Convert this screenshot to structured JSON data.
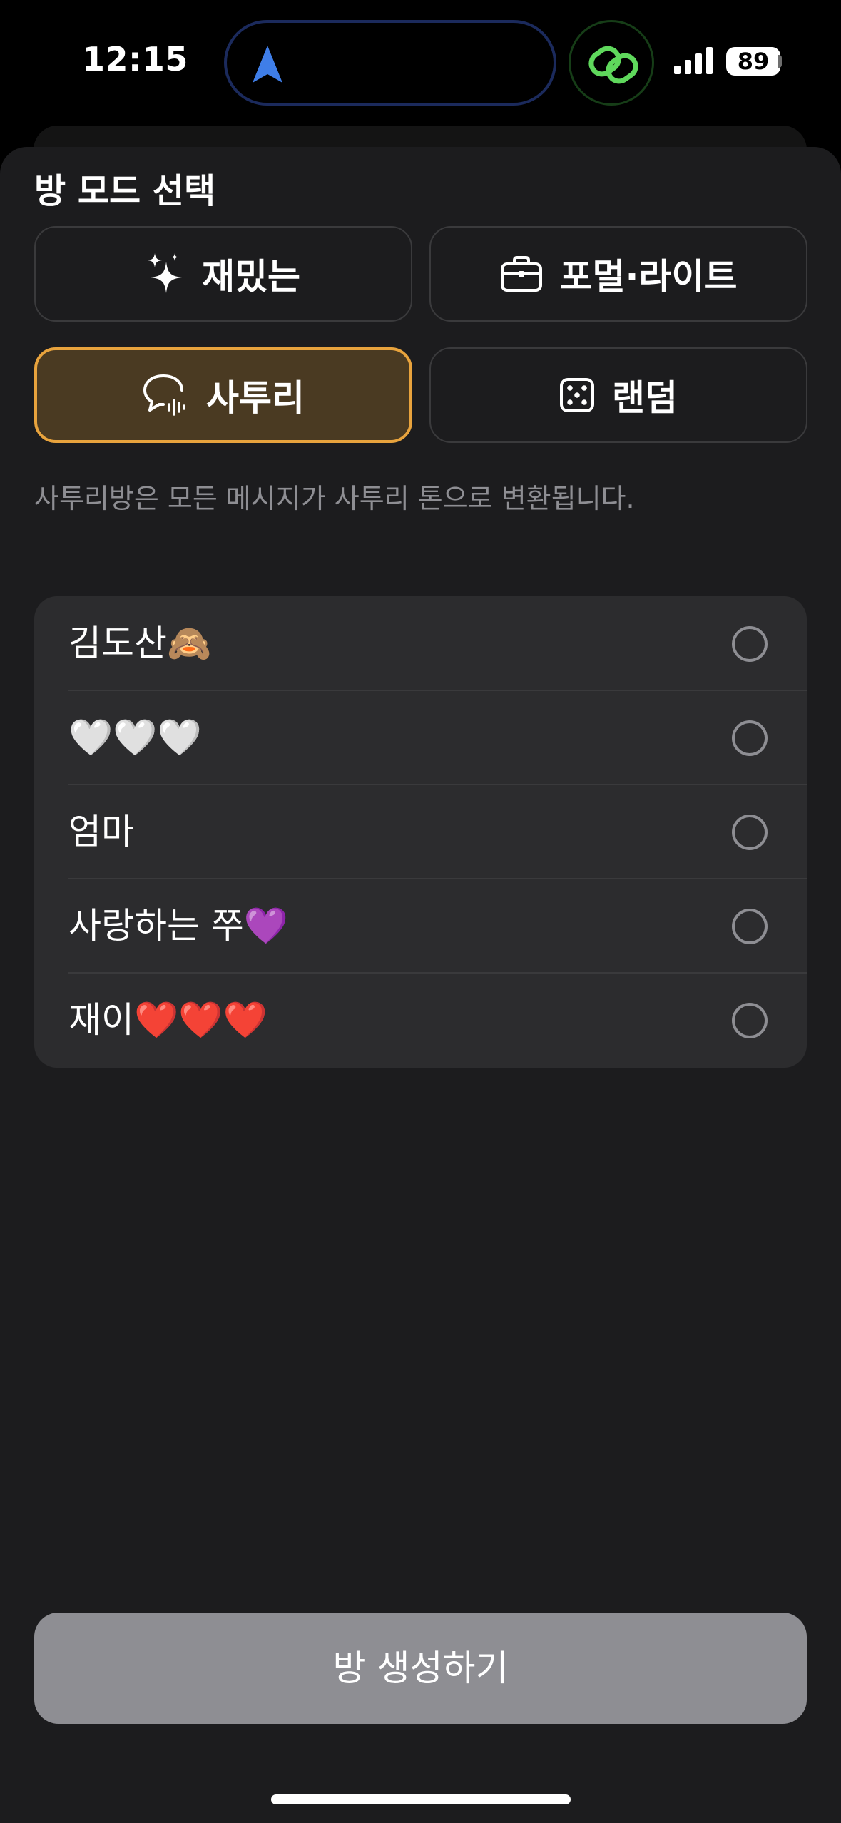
{
  "status_bar": {
    "time": "12:15",
    "battery": "89"
  },
  "sheet": {
    "title": "방 모드 선택",
    "modes": [
      {
        "label": "재밌는",
        "icon": "sparkles-icon",
        "selected": false
      },
      {
        "label": "포멀·라이트",
        "icon": "briefcase-icon",
        "selected": false
      },
      {
        "label": "사투리",
        "icon": "speech-bubble-waveform-icon",
        "selected": true
      },
      {
        "label": "랜덤",
        "icon": "dice-icon",
        "selected": false
      }
    ],
    "description": "사투리방은 모든 메시지가 사투리 톤으로 변환됩니다.",
    "contacts": [
      {
        "name": "김도산🙈",
        "checked": false
      },
      {
        "name": "🤍🤍🤍",
        "checked": false
      },
      {
        "name": "엄마",
        "checked": false
      },
      {
        "name": "사랑하는 쭈💜",
        "checked": false
      },
      {
        "name": "재이❤️❤️❤️",
        "checked": false
      }
    ],
    "create_button": "방 생성하기"
  },
  "colors": {
    "accent": "#e8a33d",
    "selected_bg": "#4a3a22",
    "sheet_bg": "#1c1c1e",
    "list_bg": "#2c2c2e",
    "disabled_button": "#8e8e93"
  }
}
